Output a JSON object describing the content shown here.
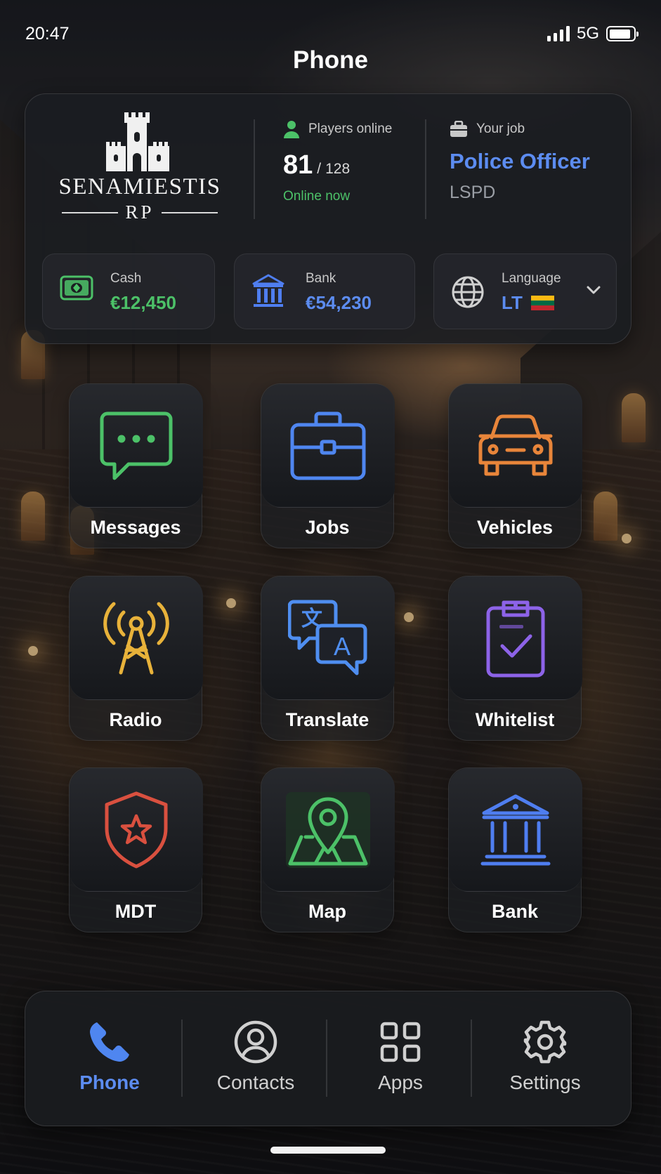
{
  "status_bar": {
    "time": "20:47",
    "network": "5G",
    "battery_percent": 90
  },
  "screen": {
    "title": "Phone"
  },
  "server": {
    "name": "SENAMIESTIS",
    "sub": "RP"
  },
  "players": {
    "label": "Players online",
    "online": "81",
    "sep": "/",
    "max": "128",
    "status": "Online now"
  },
  "job": {
    "label": "Your job",
    "title": "Police Officer",
    "department": "LSPD"
  },
  "wallet": {
    "cash": {
      "label": "Cash",
      "value": "€12,450"
    },
    "bank": {
      "label": "Bank",
      "value": "€54,230"
    }
  },
  "language": {
    "label": "Language",
    "value": "LT",
    "flag_colors": [
      "#FDB913",
      "#006A44",
      "#C1272D"
    ]
  },
  "apps": [
    {
      "label": "Messages",
      "icon": "chat-bubble-icon",
      "color": "#4cc168"
    },
    {
      "label": "Jobs",
      "icon": "briefcase-icon",
      "color": "#4f86f0"
    },
    {
      "label": "Vehicles",
      "icon": "car-icon",
      "color": "#e8853a"
    },
    {
      "label": "Radio",
      "icon": "radio-tower-icon",
      "color": "#e8b23a"
    },
    {
      "label": "Translate",
      "icon": "translate-icon",
      "color": "#4f8ef0"
    },
    {
      "label": "Whitelist",
      "icon": "clipboard-check-icon",
      "color": "#8d63e8"
    },
    {
      "label": "MDT",
      "icon": "shield-star-icon",
      "color": "#d9503f"
    },
    {
      "label": "Map",
      "icon": "map-pin-icon",
      "color": "#4cc168"
    },
    {
      "label": "Bank",
      "icon": "bank-icon",
      "color": "#4f7ef0"
    }
  ],
  "dock": [
    {
      "label": "Phone",
      "icon": "phone-icon",
      "active": true
    },
    {
      "label": "Contacts",
      "icon": "user-circle-icon",
      "active": false
    },
    {
      "label": "Apps",
      "icon": "grid-icon",
      "active": false
    },
    {
      "label": "Settings",
      "icon": "gear-icon",
      "active": false
    }
  ],
  "colors": {
    "accent_blue": "#5c8cf0",
    "accent_green": "#4cc168",
    "muted": "#9a9ea5"
  }
}
